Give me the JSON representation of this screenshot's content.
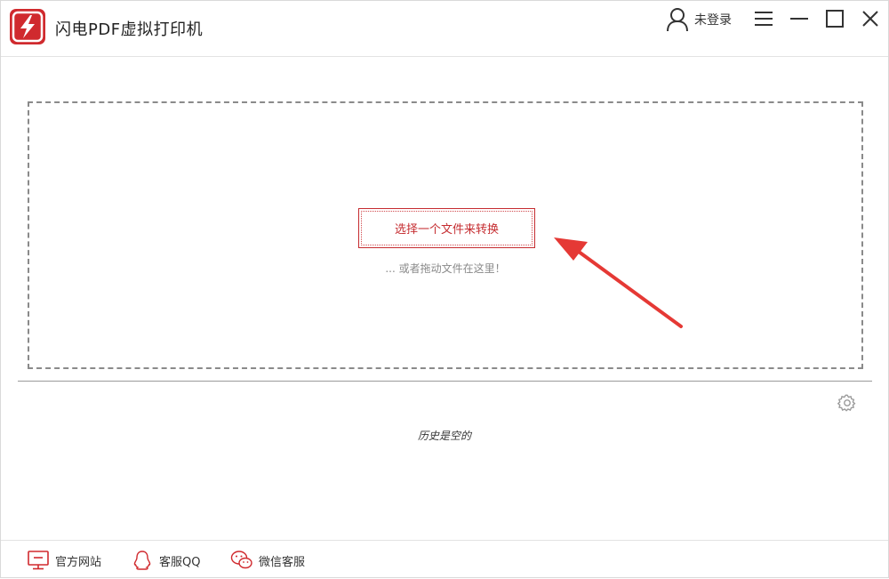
{
  "app": {
    "title": "闪电PDF虚拟打印机",
    "brand_color": "#d02a2e"
  },
  "header": {
    "user_label": "未登录",
    "user_icon": "user-icon",
    "window_controls": [
      "menu-icon",
      "minimize-icon",
      "maximize-icon",
      "close-icon"
    ]
  },
  "dropzone": {
    "select_button_label": "选择一个文件来转换",
    "drag_hint": "... 或者拖动文件在这里！",
    "accent_color": "#c52c30"
  },
  "history": {
    "empty_text": "历史是空的",
    "settings_icon": "gear-icon"
  },
  "footer": {
    "items": [
      {
        "label": "官方网站",
        "icon": "monitor-icon"
      },
      {
        "label": "客服QQ",
        "icon": "qq-icon"
      },
      {
        "label": "微信客服",
        "icon": "wechat-icon"
      }
    ]
  }
}
